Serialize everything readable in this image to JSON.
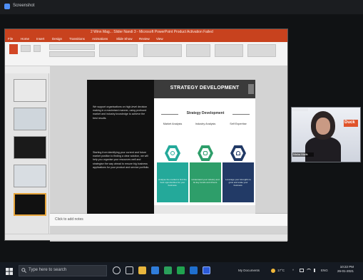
{
  "app": {
    "title": "Screenshot"
  },
  "powerpoint": {
    "window_title": "2 Winn Mag... Slider Nandi 3 - Microsoft PowerPoint Product Activation Failed",
    "tabs": [
      "File",
      "Home",
      "Insert",
      "Design",
      "Transitions",
      "Animations",
      "Slide Show",
      "Review",
      "View"
    ],
    "notes_placeholder": "Click to add notes",
    "slide": {
      "heading": "STRATEGY DEVELOPMENT",
      "paragraph1": "We support organisations on high-level decision making in a maximised manner, using profound market and industry knowledge to achieve the best results.",
      "paragraph2": "Starting from identifying your current and future market position to finding a clear solution, we will help you organise your resources well and strategise the way ahead to ensure big business applications for your product and service portfolio.",
      "diagram_title": "Strategy Development",
      "columns": [
        {
          "label": "Market Analysis",
          "caption": "Analyse the market to find the best opportunities for your business."
        },
        {
          "label": "Industry Analysis",
          "caption": "Understand your industry and its key trends and drivers."
        },
        {
          "label": "Self Expertise",
          "caption": "Leverage your strengths to grow and scale your business."
        }
      ]
    }
  },
  "webcam": {
    "participant_name": "Nisha Malik",
    "logo_text": "Duck"
  },
  "taskbar": {
    "search_placeholder": "Type here to search",
    "tray_label": "My Documents",
    "temperature": "17°C",
    "language": "ENG",
    "time": "10:22 PM",
    "date": "26-01-2021"
  },
  "colors": {
    "ppt_accent": "#c8421e",
    "teal": "#24a99a",
    "green": "#2e9e6a",
    "navy": "#223a66",
    "highlight": "#e8b04b"
  }
}
